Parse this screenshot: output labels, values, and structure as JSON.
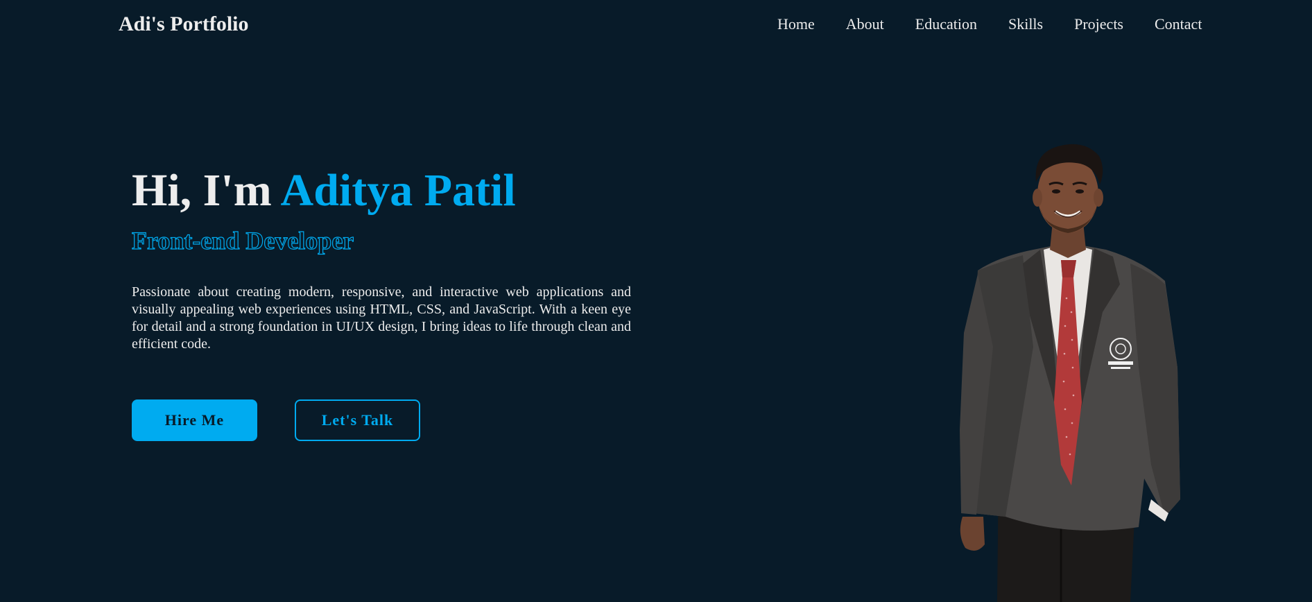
{
  "header": {
    "logo": "Adi's Portfolio",
    "nav": [
      "Home",
      "About",
      "Education",
      "Skills",
      "Projects",
      "Contact"
    ]
  },
  "hero": {
    "greeting": "Hi, I'm ",
    "name": "Aditya Patil",
    "role": "Front-end Developer",
    "description": "Passionate about creating modern, responsive, and interactive web applications and visually appealing web experiences using HTML, CSS, and JavaScript. With a keen eye for detail and a strong foundation in UI/UX design, I bring ideas to life through clean and efficient code.",
    "buttons": {
      "hire": "Hire Me",
      "talk": "Let's Talk"
    }
  },
  "colors": {
    "background": "#081b29",
    "accent": "#00abf0",
    "text": "#ededed"
  }
}
